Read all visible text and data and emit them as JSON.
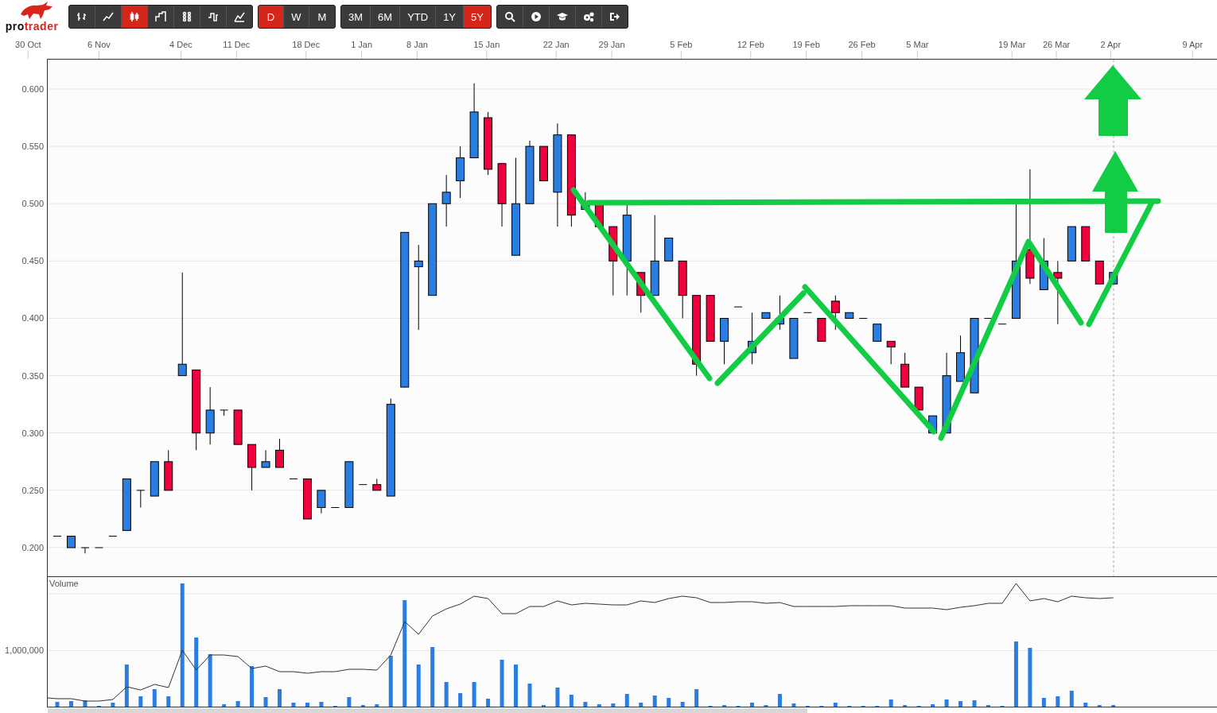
{
  "logo": {
    "text_start": "pro",
    "text_end": "trader"
  },
  "chart_types": [
    {
      "kind": "ohlc",
      "selected": false
    },
    {
      "kind": "line",
      "selected": false
    },
    {
      "kind": "candles",
      "selected": true
    },
    {
      "kind": "step",
      "selected": false
    },
    {
      "kind": "dots",
      "selected": false
    },
    {
      "kind": "kagi",
      "selected": false
    },
    {
      "kind": "area",
      "selected": false
    }
  ],
  "intervals": [
    {
      "label": "D",
      "selected": true
    },
    {
      "label": "W",
      "selected": false
    },
    {
      "label": "M",
      "selected": false
    }
  ],
  "ranges": [
    {
      "label": "3M",
      "selected": false
    },
    {
      "label": "6M",
      "selected": false
    },
    {
      "label": "YTD",
      "selected": false
    },
    {
      "label": "1Y",
      "selected": false
    },
    {
      "label": "5Y",
      "selected": true
    }
  ],
  "tools": [
    {
      "kind": "search"
    },
    {
      "kind": "play"
    },
    {
      "kind": "learn"
    },
    {
      "kind": "settings"
    },
    {
      "kind": "exit"
    }
  ],
  "price_chart": {
    "date_labels": [
      "30 Oct",
      "6 Nov",
      "4 Dec",
      "11 Dec",
      "18 Dec",
      "1 Jan",
      "8 Jan",
      "15 Jan",
      "22 Jan",
      "29 Jan",
      "5 Feb",
      "12 Feb",
      "19 Feb",
      "26 Feb",
      "5 Mar",
      "19 Mar",
      "26 Mar",
      "2 Apr",
      "9 Apr"
    ],
    "price_labels": [
      "0.600",
      "0.550",
      "0.500",
      "0.450",
      "0.400",
      "0.350",
      "0.300",
      "0.250",
      "0.200"
    ]
  },
  "volume_panel": {
    "title": "Volume",
    "axis_label": "1,000,000"
  }
}
